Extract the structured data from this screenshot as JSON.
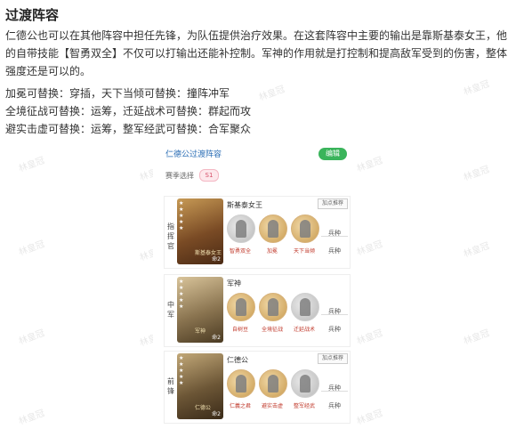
{
  "article": {
    "heading": "过渡阵容",
    "paragraph": "仁德公也可以在其他阵容中担任先锋，为队伍提供治疗效果。在这套阵容中主要的输出是靠斯基泰女王，他的自带技能【智勇双全】不仅可以打输出还能补控制。军神的作用就是打控制和提高敌军受到的伤害，整体强度还是可以的。",
    "line1": "加冕可替换：穿插，天下当倾可替换：撞阵冲军",
    "line2": "全境征战可替换：运筹，迁延战术可替换：群起而攻",
    "line3": "避实击虚可替换：运筹，整军经武可替换：合军聚众"
  },
  "watermark": "林皇冠",
  "card": {
    "title": "仁德公过渡阵容",
    "edit_label": "编辑",
    "season_label": "赛季选择",
    "season_value": "S1",
    "rows": [
      {
        "role": "指挥官",
        "general_name": "斯基泰女王",
        "suggest_label": "加点推荐",
        "portrait_tag": "斯基泰女王",
        "level": "命2",
        "skills": [
          "智勇双全",
          "加冕",
          "天下当倾"
        ],
        "troop_label": "兵种",
        "troop_value": "兵种",
        "colors": {
          "portrait": "#8a5a2b"
        }
      },
      {
        "role": "中军",
        "general_name": "军神",
        "suggest_label": "加点推荐",
        "portrait_tag": "军神",
        "level": "命2",
        "skills": [
          "自树豆",
          "全境征战",
          "迁延战术"
        ],
        "troop_label": "兵种",
        "troop_value": "兵种",
        "colors": {
          "portrait": "#7a6a4a"
        }
      },
      {
        "role": "前锋",
        "general_name": "仁德公",
        "suggest_label": "加点推荐",
        "portrait_tag": "仁德公",
        "level": "命2",
        "skills": [
          "仁義之君",
          "避实击虚",
          "整军经武"
        ],
        "troop_label": "兵种",
        "troop_value": "兵种",
        "colors": {
          "portrait": "#6a5a3a"
        }
      }
    ]
  }
}
